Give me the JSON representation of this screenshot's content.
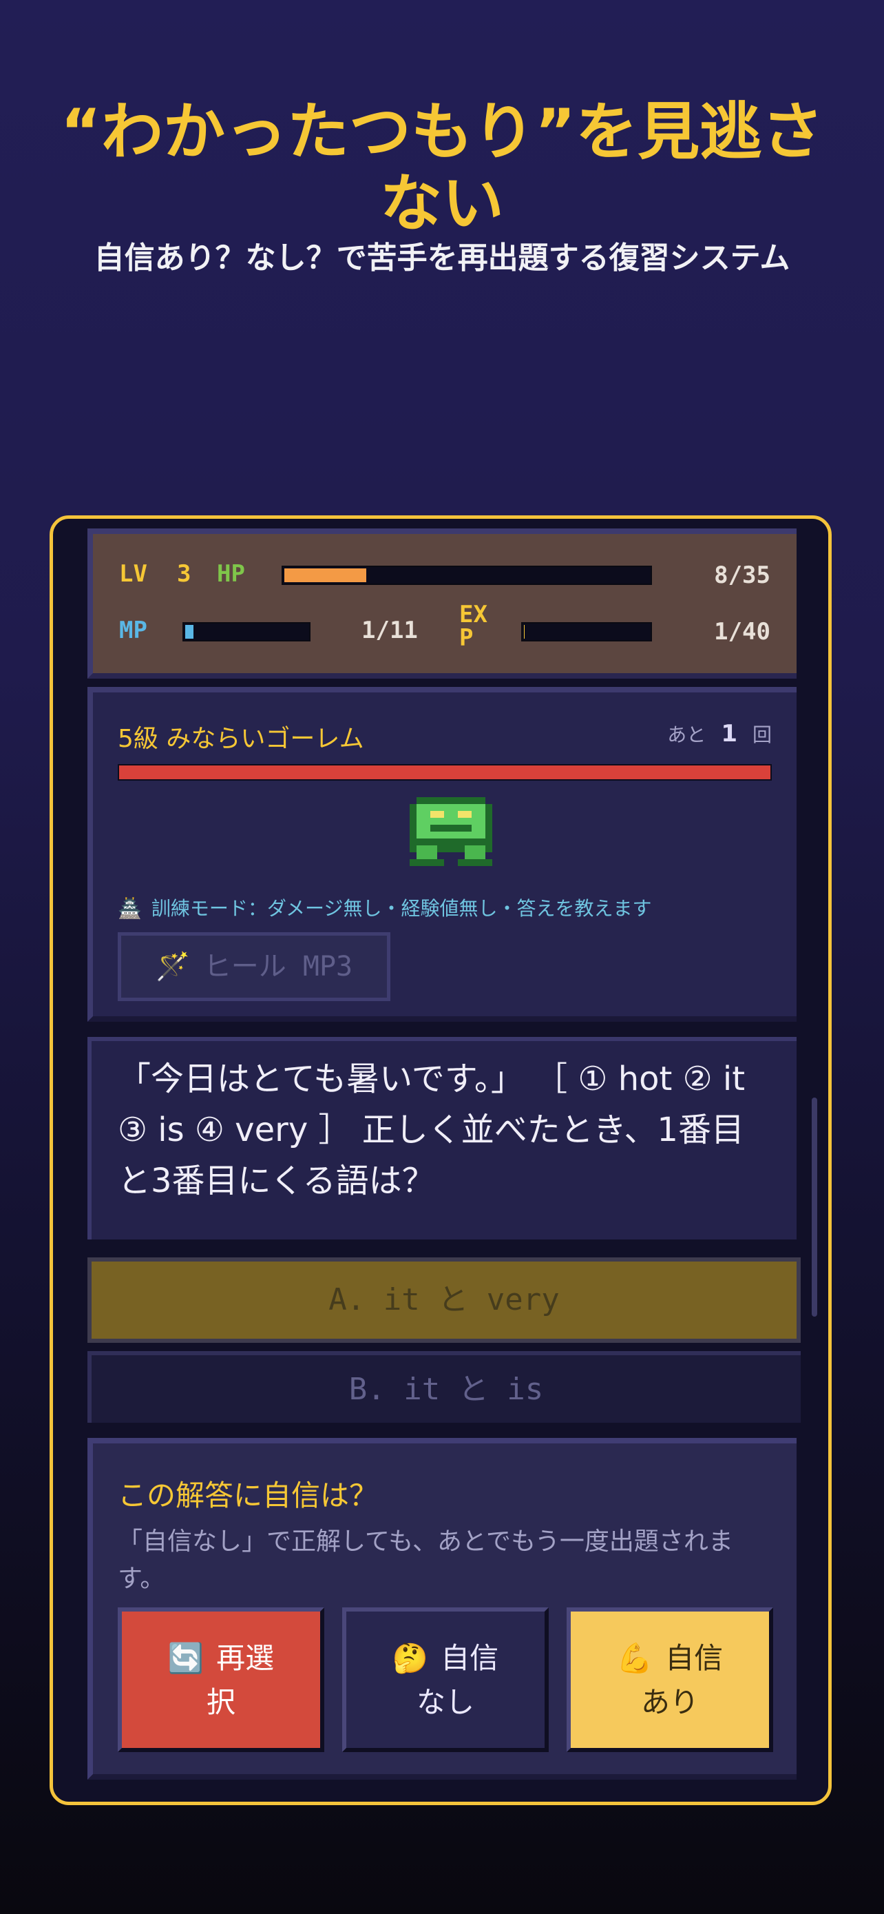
{
  "header": {
    "title": "“わかったつもり”を見逃さない",
    "subtitle": "自信あり？なし？で苦手を再出題する復習システム"
  },
  "status": {
    "lv_label": "LV",
    "lv_value": "3",
    "hp_label": "HP",
    "hp_text": "8/35",
    "hp_fraction": 0.23,
    "mp_label": "MP",
    "mp_text": "1/11",
    "mp_fraction": 0.09,
    "exp_label_1": "EX",
    "exp_label_2": "P",
    "exp_text": "1/40",
    "exp_fraction": 0.025,
    "colors": {
      "hp": "#f39a45",
      "mp": "#5ab7e6",
      "exp": "#f6c735"
    }
  },
  "enemy": {
    "name": "5級 みならいゴーレム",
    "remain_prefix": "あと",
    "remain_count": "1",
    "remain_suffix": "回",
    "hp_fraction": 1.0,
    "icon": "green-golem-sprite",
    "training_icon": "castle-icon",
    "training_text": "訓練モード：ダメージ無し・経験値無し・答えを教えます",
    "heal_icon": "magic-wand-icon",
    "heal_label": "ヒール MP3"
  },
  "question": {
    "text": "「今日はとても暑いです。」 ［ ① hot ② it ③ is ④ very ］ 正しく並べたとき、1番目と3番目にくる語は？"
  },
  "choices": [
    {
      "label": "A. it と very",
      "state": "selected"
    },
    {
      "label": "B. it と is",
      "state": "normal"
    }
  ],
  "confidence": {
    "question": "この解答に自信は？",
    "note": "「自信なし」で正解しても、あとでもう一度出題されます。",
    "buttons": [
      {
        "icon": "🔄",
        "label_1": "再選",
        "label_2": "択"
      },
      {
        "icon": "🤔",
        "label_1": "自信",
        "label_2": "なし"
      },
      {
        "icon": "💪",
        "label_1": "自信",
        "label_2": "あり"
      }
    ]
  }
}
